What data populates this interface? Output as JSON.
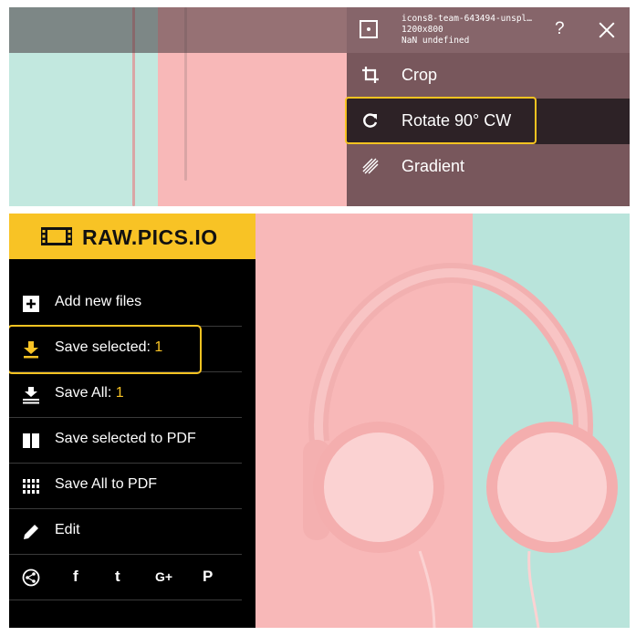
{
  "top_panel": {
    "file_info": {
      "filename": "icons8-team-643494-unspl…",
      "dimensions": "1200x800",
      "meta": "NaN undefined"
    },
    "help_label": "?",
    "menu_items": [
      {
        "label": "Crop",
        "icon": "crop-icon"
      },
      {
        "label": "Rotate 90° CW",
        "icon": "rotate-cw-icon",
        "active": true
      },
      {
        "label": "Gradient",
        "icon": "gradient-icon"
      }
    ]
  },
  "bottom_panel": {
    "logo_text": "RAW.PICS.IO",
    "menu_items": [
      {
        "label": "Add new files",
        "icon": "add-icon"
      },
      {
        "label": "Save selected: ",
        "count": "1",
        "icon": "download-icon",
        "highlighted": true
      },
      {
        "label": "Save All: ",
        "count": "1",
        "icon": "download-all-icon"
      },
      {
        "label": "Save selected to PDF",
        "icon": "pdf-icon"
      },
      {
        "label": "Save All to PDF",
        "icon": "grid-icon"
      },
      {
        "label": "Edit",
        "icon": "pencil-icon"
      }
    ],
    "social": [
      "share-icon",
      "facebook-icon",
      "tumblr-icon",
      "google-plus-icon",
      "pinterest-icon"
    ],
    "social_glyphs": [
      "f",
      "t",
      "G+",
      "P"
    ]
  },
  "colors": {
    "accent": "#f8c325",
    "pink": "#f8b8b8",
    "mint": "#c2e8df",
    "sidebar": "#000000"
  }
}
